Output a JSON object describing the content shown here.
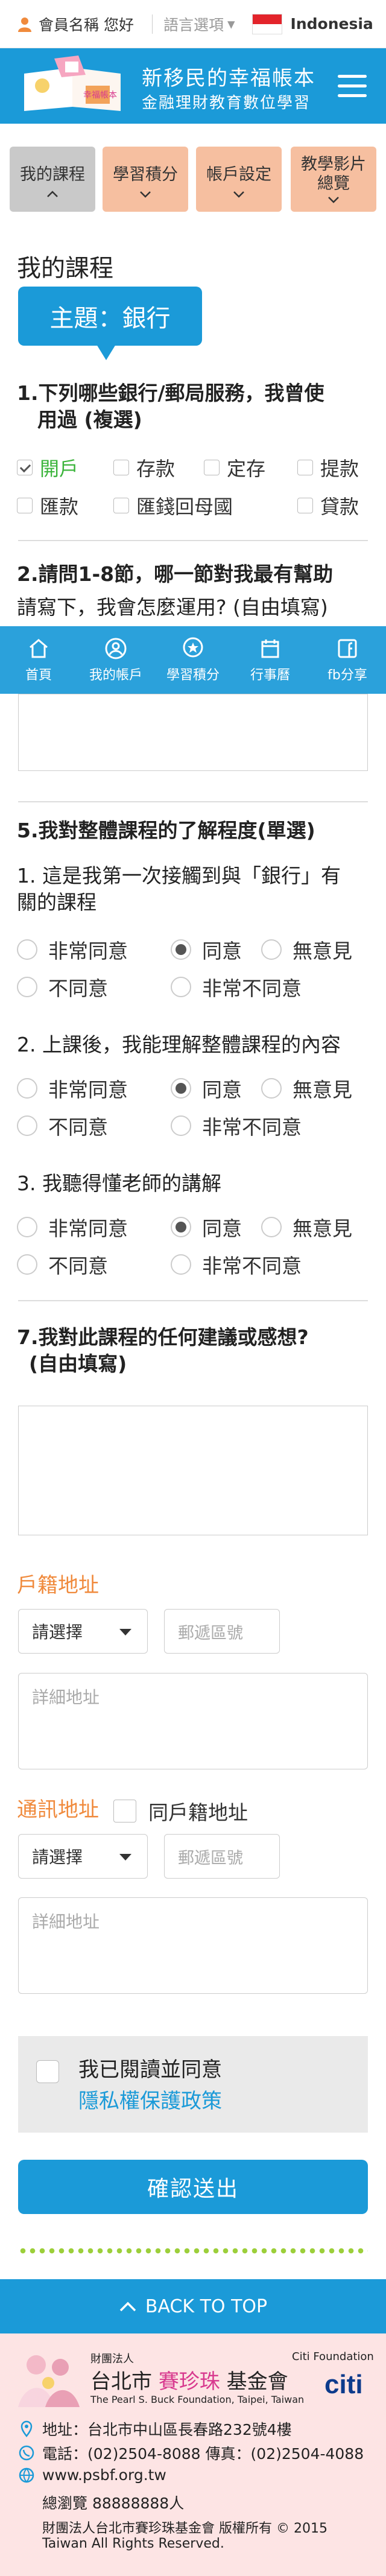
{
  "topbar": {
    "user_label": "會員名稱 您好",
    "lang_label": "語言選項",
    "lang_arrow": "▾",
    "country": "Indonesia"
  },
  "header": {
    "title_line1": "新移民的幸福帳本",
    "title_line2": "金融理財教育數位學習",
    "logo_caption": "幸福帳本"
  },
  "nav": {
    "tabs": [
      {
        "label": "我的課程"
      },
      {
        "label": "學習積分"
      },
      {
        "label": "帳戶設定"
      },
      {
        "label": "教學影片",
        "label2": "總覽"
      }
    ]
  },
  "course": {
    "section_title": "我的課程",
    "topic": "主題：銀行",
    "q1": {
      "line1": "1.下列哪些銀行/郵局服務，我曾使",
      "line2": "用過 (複選)",
      "options": [
        {
          "label": "開戶",
          "checked": true
        },
        {
          "label": "存款",
          "checked": false
        },
        {
          "label": "定存",
          "checked": false
        },
        {
          "label": "提款",
          "checked": false
        },
        {
          "label": "匯款",
          "checked": false
        },
        {
          "label": "匯錢回母國",
          "checked": false
        },
        {
          "label": "貸款",
          "checked": false
        }
      ]
    },
    "q2": {
      "line1": "2.請問1-8節，哪一節對我最有幫助",
      "line2": "請寫下，我會怎麼運用? (自由填寫)"
    },
    "q5": {
      "title": "5.我對整體課程的了解程度(單選)",
      "items": [
        {
          "line1": "1. 這是我第一次接觸到與「銀行」有",
          "line2": "關的課程",
          "selected": "同意"
        },
        {
          "line1": "2. 上課後，我能理解整體課程的內容",
          "line2": "",
          "selected": "同意"
        },
        {
          "line1": "3. 我聽得懂老師的講解",
          "line2": "",
          "selected": "同意"
        }
      ],
      "choices": [
        "非常同意",
        "同意",
        "無意見",
        "不同意",
        "非常不同意"
      ]
    },
    "q7": {
      "line1": "7.我對此課程的任何建議或感想?",
      "line2": "(自由填寫)"
    }
  },
  "address": {
    "household_label": "戶籍地址",
    "mailing_label": "通訊地址",
    "same_as_household": "同戶籍地址",
    "select_placeholder": "請選擇",
    "zip_placeholder": "郵遞區號",
    "detail_placeholder": "詳細地址"
  },
  "privacy": {
    "text": "我已閱讀並同意",
    "link": "隱私權保護政策"
  },
  "submit_label": "確認送出",
  "bottom_nav": [
    {
      "label": "首頁",
      "icon": "home-icon"
    },
    {
      "label": "我的帳戶",
      "icon": "user-icon"
    },
    {
      "label": "學習積分",
      "icon": "star-icon"
    },
    {
      "label": "行事曆",
      "icon": "calendar-icon"
    },
    {
      "label": "fb分享",
      "icon": "facebook-icon"
    }
  ],
  "back_to_top": "BACK TO TOP",
  "footer": {
    "org_small": "財團法人",
    "org_city": "台北市",
    "org_name": "賽珍珠",
    "org_suffix": "基金會",
    "org_en": "The Pearl S. Buck Foundation, Taipei, Taiwan",
    "citi_small": "Citi Foundation",
    "citi_logo": "citi",
    "address": "地址：台北市中山區長春路232號4樓",
    "phone": "電話：(02)2504-8088  傳真：(02)2504-4088",
    "website": "www.psbf.org.tw",
    "visits": "總瀏覽 88888888人",
    "copyright1": "財團法人台北市賽珍珠基金會 版權所有 © 2015",
    "copyright2": "Taiwan All Rights Reserved."
  },
  "colors": {
    "brand_blue": "#1b9ad8",
    "tab_orange": "#f6bfa0",
    "tab_active": "#c9c9c9",
    "address_orange": "#f08a3c",
    "dot_green": "#9ccf3a",
    "footer_pink": "#fde4e4"
  }
}
